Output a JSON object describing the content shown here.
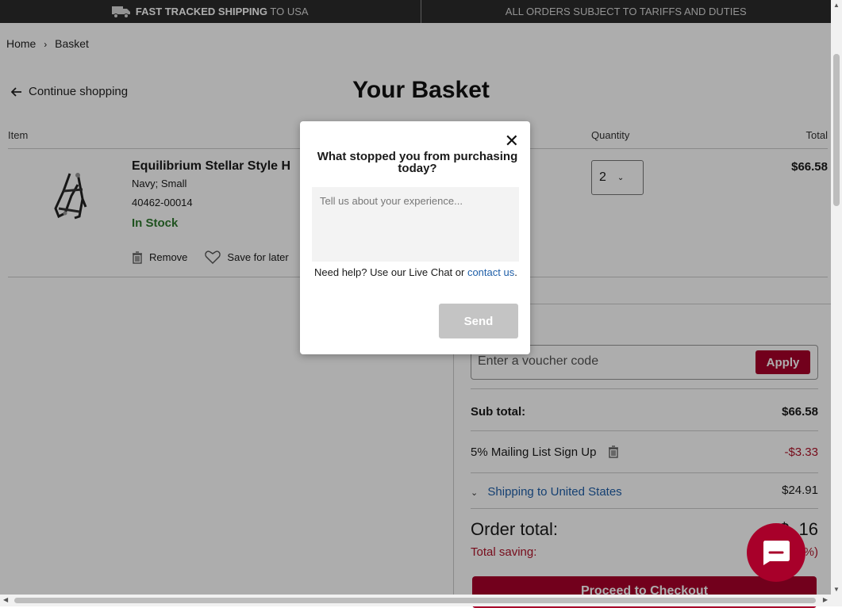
{
  "topbar": {
    "shipping_bold": "FAST TRACKED SHIPPING",
    "shipping_rest": " TO USA",
    "tariffs": "ALL ORDERS SUBJECT TO TARIFFS AND DUTIES"
  },
  "breadcrumb": {
    "home": "Home",
    "separator": "›",
    "current": "Basket"
  },
  "continue_label": "Continue shopping",
  "page_title": "Your Basket",
  "table_headers": {
    "item": "Item",
    "quantity": "Quantity",
    "total": "Total"
  },
  "product": {
    "name": "Equilibrium Stellar Style H",
    "variant": "Navy; Small",
    "sku": "40462-00014",
    "stock": "In Stock",
    "remove_label": "Remove",
    "save_label": "Save for later",
    "quantity": "2",
    "total": "$66.58"
  },
  "summary": {
    "heading_partial": "rder",
    "voucher_placeholder": "Enter a voucher code",
    "apply_label": "Apply",
    "subtotal_label": "Sub total:",
    "subtotal_value": "$66.58",
    "discount_label": "5% Mailing List Sign Up",
    "discount_value": "-$3.33",
    "shipping_label": "Shipping to United States",
    "shipping_value": "$24.91",
    "order_total_label": "Order total:",
    "order_total_partial": "$ .16",
    "saving_label": "Total saving:",
    "saving_partial": "%)",
    "checkout_label": "Proceed to Checkout"
  },
  "modal": {
    "title": "What stopped you from purchasing today?",
    "textarea_placeholder": "Tell us about your experience...",
    "help_prefix": "Need help? Use our Live Chat or ",
    "help_link": "contact us",
    "help_suffix": ".",
    "send_label": "Send"
  },
  "colors": {
    "brand": "#a8002a",
    "link": "#1f5fa8",
    "stock": "#2f7a2f"
  }
}
